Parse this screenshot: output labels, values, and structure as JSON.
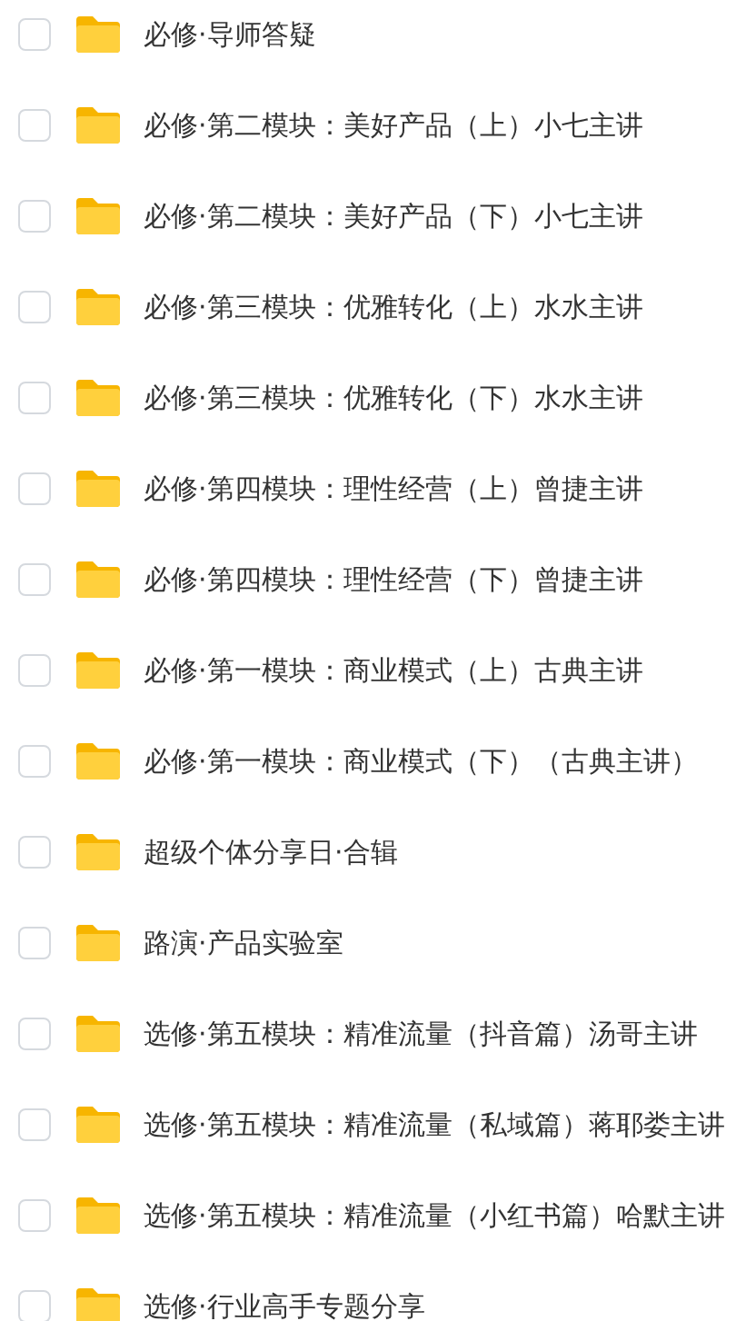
{
  "folders": [
    {
      "name": "必修·导师答疑",
      "checked": false
    },
    {
      "name": "必修·第二模块：美好产品（上）小七主讲",
      "checked": false
    },
    {
      "name": "必修·第二模块：美好产品（下）小七主讲",
      "checked": false
    },
    {
      "name": "必修·第三模块：优雅转化（上）水水主讲",
      "checked": false
    },
    {
      "name": "必修·第三模块：优雅转化（下）水水主讲",
      "checked": false
    },
    {
      "name": "必修·第四模块：理性经营（上）曾捷主讲",
      "checked": false
    },
    {
      "name": "必修·第四模块：理性经营（下）曾捷主讲",
      "checked": false
    },
    {
      "name": "必修·第一模块：商业模式（上）古典主讲",
      "checked": false
    },
    {
      "name": "必修·第一模块：商业模式（下）（古典主讲）",
      "checked": false
    },
    {
      "name": "超级个体分享日·合辑",
      "checked": false
    },
    {
      "name": "路演·产品实验室",
      "checked": false
    },
    {
      "name": "选修·第五模块：精准流量（抖音篇）汤哥主讲",
      "checked": false
    },
    {
      "name": "选修·第五模块：精准流量（私域篇）蒋耶娄主讲",
      "checked": false
    },
    {
      "name": "选修·第五模块：精准流量（小红书篇）哈默主讲",
      "checked": false
    },
    {
      "name": "选修·行业高手专题分享",
      "checked": false
    }
  ]
}
